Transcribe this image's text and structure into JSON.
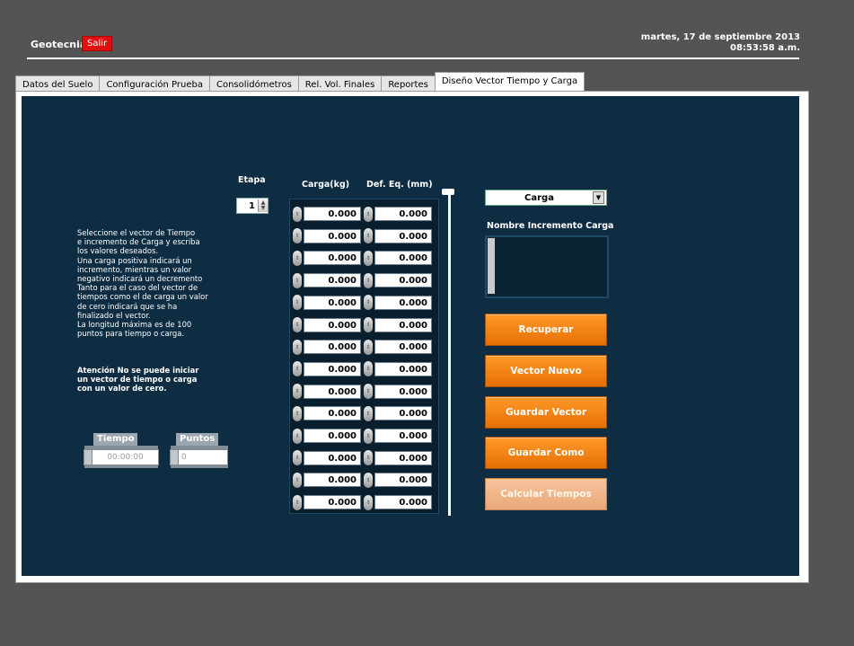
{
  "header": {
    "app_title": "Geotecnia",
    "exit_label": "Salir",
    "date": "martes, 17 de septiembre  2013",
    "time": "08:53:58 a.m."
  },
  "tabs": [
    {
      "label": "Datos del Suelo"
    },
    {
      "label": "Configuración Prueba"
    },
    {
      "label": "Consolidómetros"
    },
    {
      "label": "Rel. Vol. Finales"
    },
    {
      "label": "Reportes"
    },
    {
      "label": "Diseño Vector Tiempo y Carga"
    }
  ],
  "help_text": "Seleccione el vector de Tiempo\ne incremento de Carga y escriba\nlos valores deseados.\nUna carga positiva indicará un\nincremento, mientras un valor\nnegativo indicará un decremento\nTanto para el caso del vector de\ntiempos como el de carga un valor\nde cero indicará que se ha\nfinalizado el vector.\nLa longitud máxima es de 100\npuntos para tiempo o carga.",
  "warning_text": "Atención No se puede iniciar\nun vector de tiempo o carga\ncon un valor de cero.",
  "etapa": {
    "label": "Etapa",
    "value": "1"
  },
  "table": {
    "col_carga": "Carga(kg)",
    "col_def": "Def. Eq. (mm)",
    "rows": [
      {
        "carga": "0.000",
        "def": "0.000"
      },
      {
        "carga": "0.000",
        "def": "0.000"
      },
      {
        "carga": "0.000",
        "def": "0.000"
      },
      {
        "carga": "0.000",
        "def": "0.000"
      },
      {
        "carga": "0.000",
        "def": "0.000"
      },
      {
        "carga": "0.000",
        "def": "0.000"
      },
      {
        "carga": "0.000",
        "def": "0.000"
      },
      {
        "carga": "0.000",
        "def": "0.000"
      },
      {
        "carga": "0.000",
        "def": "0.000"
      },
      {
        "carga": "0.000",
        "def": "0.000"
      },
      {
        "carga": "0.000",
        "def": "0.000"
      },
      {
        "carga": "0.000",
        "def": "0.000"
      },
      {
        "carga": "0.000",
        "def": "0.000"
      },
      {
        "carga": "0.000",
        "def": "0.000"
      }
    ]
  },
  "vector_type": {
    "value": "Carga"
  },
  "name_field": {
    "label": "Nombre Incremento Carga",
    "value": ""
  },
  "buttons": {
    "recuperar": "Recuperar",
    "vector_nuevo": "Vector Nuevo",
    "guardar_vector": "Guardar Vector",
    "guardar_como": "Guardar Como",
    "calcular_tiempos": "Calcular Tiempos"
  },
  "tiempo": {
    "label": "Tiempo",
    "value": "00:00:00"
  },
  "puntos": {
    "label": "Puntos",
    "value": "0"
  },
  "colors": {
    "background": "#545454",
    "panel": "#0e2d42",
    "accent_orange": "#f08010",
    "exit_red": "#e01010"
  }
}
